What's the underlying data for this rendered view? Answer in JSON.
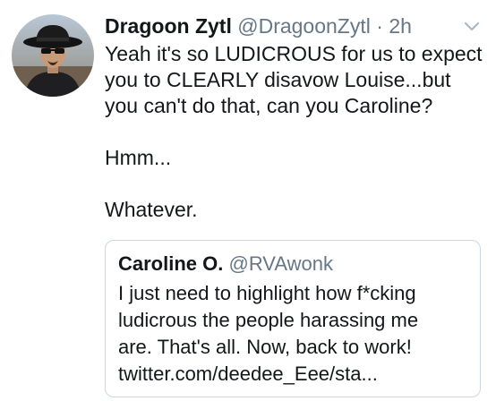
{
  "tweet": {
    "author": {
      "display_name": "Dragoon Zytl",
      "handle": "@DragoonZytl",
      "separator": "·",
      "time": "2h",
      "avatar_icon": "user-avatar-cowboy-hat"
    },
    "menu_icon": "chevron-down-icon",
    "text_lines": [
      "Yeah it's so LUDICROUS for us to expect",
      "you to CLEARLY disavow Louise...but",
      "you can't do that, can you Caroline?",
      "Hmm...",
      "Whatever."
    ],
    "quoted_tweet": {
      "display_name": "Caroline O.",
      "handle": "@RVAwonk",
      "text_lines": [
        "I just need to highlight how f*cking",
        "ludicrous the people harassing me",
        "are. That's all. Now, back to work!",
        "twitter.com/deedee_Eee/sta..."
      ]
    }
  },
  "colors": {
    "text_primary": "#14171a",
    "text_secondary": "#657786",
    "border": "#ccd6dd"
  }
}
